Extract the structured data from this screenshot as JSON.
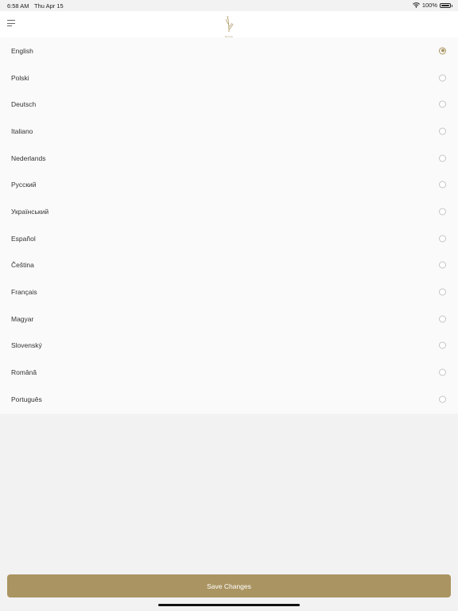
{
  "status_bar": {
    "time": "6:58 AM",
    "date": "Thu Apr 15",
    "battery": "100%",
    "icons": [
      "wifi-icon",
      "battery-icon"
    ]
  },
  "header": {
    "menu_icon": "hamburger-menu-icon",
    "logo_icon": "wheat-logo-icon",
    "logo_text": "Ecoria"
  },
  "languages": [
    {
      "label": "English",
      "selected": true
    },
    {
      "label": "Polski",
      "selected": false
    },
    {
      "label": "Deutsch",
      "selected": false
    },
    {
      "label": "Italiano",
      "selected": false
    },
    {
      "label": "Nederlands",
      "selected": false
    },
    {
      "label": "Русский",
      "selected": false
    },
    {
      "label": "Український",
      "selected": false
    },
    {
      "label": "Español",
      "selected": false
    },
    {
      "label": "Čeština",
      "selected": false
    },
    {
      "label": "Français",
      "selected": false
    },
    {
      "label": "Magyar",
      "selected": false
    },
    {
      "label": "Slovenský",
      "selected": false
    },
    {
      "label": "Română",
      "selected": false
    },
    {
      "label": "Português",
      "selected": false
    }
  ],
  "footer": {
    "save_label": "Save Changes"
  },
  "colors": {
    "accent": "#aa9461",
    "background": "#f2f2f2",
    "list_background": "#fafafa"
  }
}
